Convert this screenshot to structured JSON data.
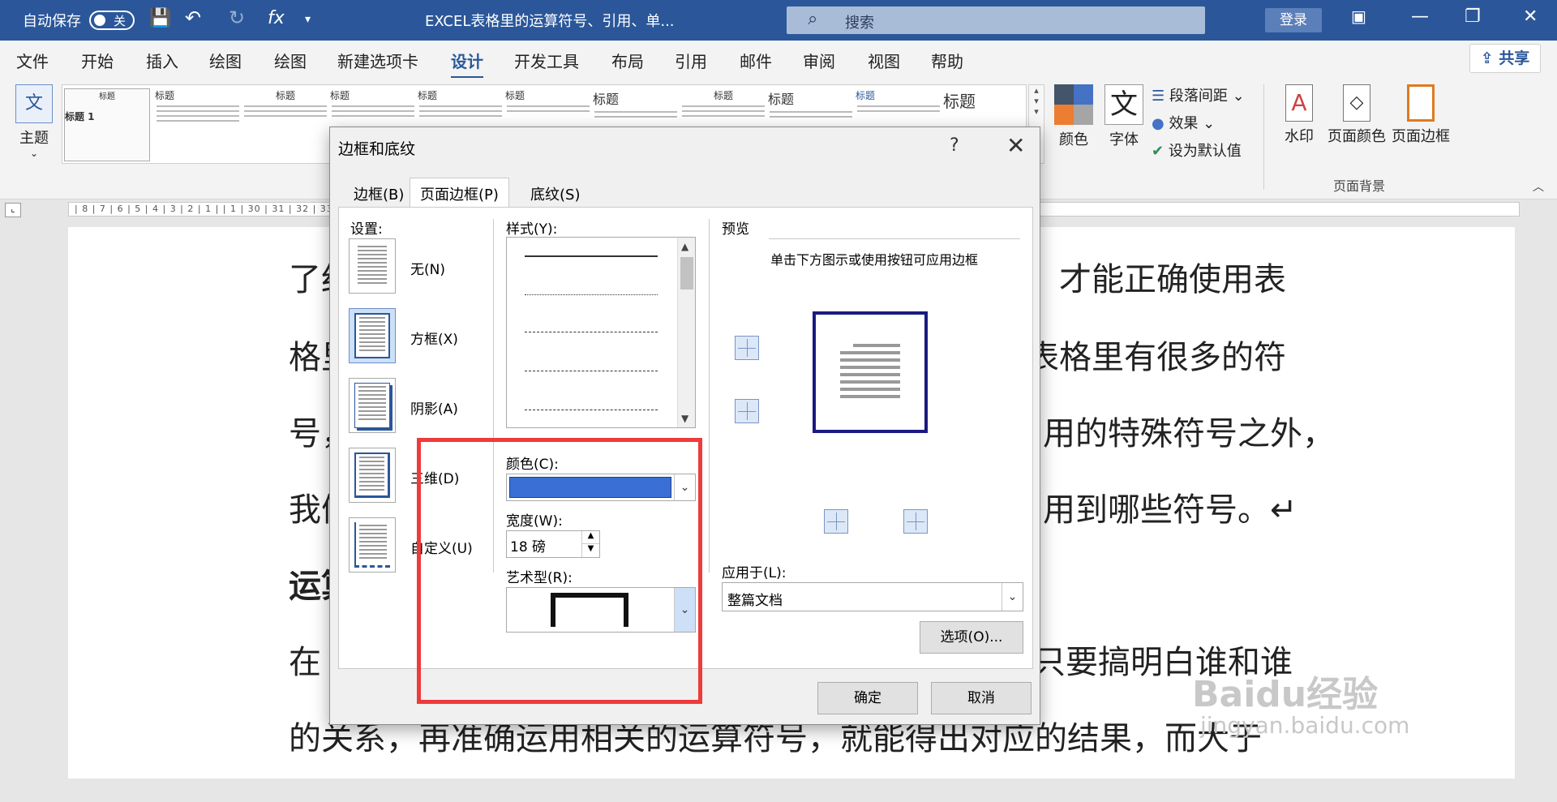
{
  "titlebar": {
    "autosave_label": "自动保存",
    "autosave_state": "关",
    "doc_title": "EXCEL表格里的运算符号、引用、单...",
    "search_placeholder": "搜索",
    "login_label": "登录"
  },
  "tabs": [
    "文件",
    "开始",
    "插入",
    "绘图",
    "绘图",
    "新建选项卡",
    "设计",
    "开发工具",
    "布局",
    "引用",
    "邮件",
    "审阅",
    "视图",
    "帮助"
  ],
  "active_tab": "设计",
  "share_label": "共享",
  "ribbon": {
    "theme_label": "主题",
    "theme_icon_text": "文",
    "gallery": {
      "items": [
        "标题",
        "标题",
        "标题",
        "标题",
        "标题",
        "标题",
        "标题",
        "标题",
        "标题",
        "标题",
        "标题"
      ],
      "subtitle": "标题 1"
    },
    "colors_label": "颜色",
    "fonts_label": "字体",
    "fonts_icon_text": "文",
    "paragraph_spacing": "段落间距",
    "effects": "效果",
    "set_default": "设为默认值",
    "watermark": "水印",
    "page_color": "页面颜色",
    "page_borders": "页面边框",
    "group_page_background": "页面背景"
  },
  "ruler": {
    "text": "| 8 | 7 | 6 | 5 | 4 | 3 | 2 | 1 |    | 1 |                                                                                                                                                                                                                                                       30 | 31 | 32 | 33 | 34 | 35 | 36 | 37 | 38 | 39 |  40 | 41 | 42 | 43 | 44 | 45 | 46 | 47 | 48"
  },
  "document": {
    "lines": [
      "了红",
      "才能正确使用表",
      "格里",
      "表格里有很多的符",
      "号，",
      "用的特殊符号之外，",
      "我们",
      "用到哪些符号。↵",
      "运算",
      "在",
      "只要搞明白谁和谁",
      "的关系，再准确运用相关的运算符号，就能得出对应的结果，而大于"
    ]
  },
  "watermark": {
    "brand": "Baidu经验",
    "url": "jingyan.baidu.com"
  },
  "dialog": {
    "title": "边框和底纹",
    "help": "?",
    "close": "✕",
    "tabs": [
      "边框(B)",
      "页面边框(P)",
      "底纹(S)"
    ],
    "active_tab": "页面边框(P)",
    "settings_label": "设置:",
    "settings": [
      "无(N)",
      "方框(X)",
      "阴影(A)",
      "三维(D)",
      "自定义(U)"
    ],
    "style_label": "样式(Y):",
    "color_label": "颜色(C):",
    "color_value": "#3a6fd6",
    "width_label": "宽度(W):",
    "width_value": "18 磅",
    "art_label": "艺术型(R):",
    "preview_label": "预览",
    "preview_hint": "单击下方图示或使用按钮可应用边框",
    "apply_label": "应用于(L):",
    "apply_value": "整篇文档",
    "options_button": "选项(O)...",
    "ok_button": "确定",
    "cancel_button": "取消"
  },
  "colors": {
    "titlebar": "#2b579a",
    "highlight": "#ee3b3b",
    "border_color": "#3a6fd6"
  }
}
